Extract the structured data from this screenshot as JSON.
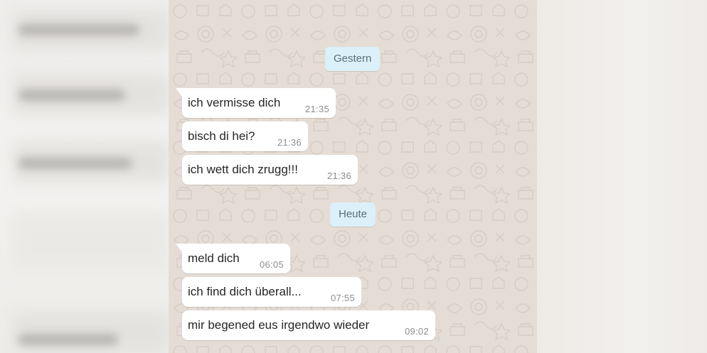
{
  "chat": {
    "date_chips": [
      "Gestern",
      "Heute"
    ],
    "messages": [
      {
        "text": "ich vermisse dich",
        "time": "21:35"
      },
      {
        "text": "bisch di hei?",
        "time": "21:36"
      },
      {
        "text": "ich wett dich zrugg!!!",
        "time": "21:36"
      },
      {
        "text": "meld dich",
        "time": "06:05"
      },
      {
        "text": "ich find dich überall...",
        "time": "07:55"
      },
      {
        "text": "mir begened eus irgendwo wieder",
        "time": "09:02"
      }
    ]
  },
  "colors": {
    "chat_background": "#e5ddd5",
    "date_chip": "#dcf0f9",
    "bubble": "#ffffff",
    "timestamp": "#8a8d90"
  }
}
